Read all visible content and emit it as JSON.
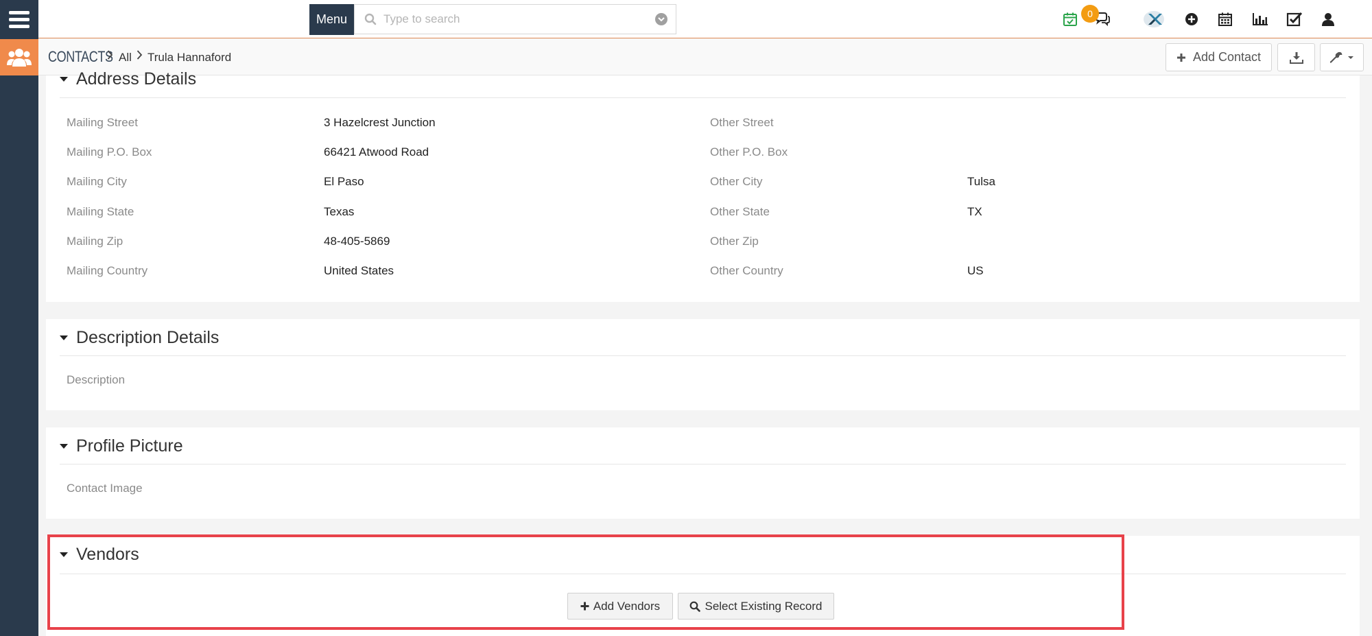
{
  "topbar": {
    "menu_label": "Menu",
    "search_placeholder": "Type to search",
    "notification_count": "0",
    "icons": [
      "calendar-check-icon",
      "chat-icon",
      "app-logo-icon",
      "plus-circle-icon",
      "calendar-icon",
      "bar-chart-icon",
      "checkbox-icon",
      "user-icon"
    ],
    "accent_color": "#f08a4b",
    "nav_color": "#2a3a4c"
  },
  "breadcrumb": {
    "module": "CONTACTS",
    "all": "All",
    "record": "Trula Hannaford"
  },
  "header_actions": {
    "add_contact": "Add Contact"
  },
  "address": {
    "title": "Address Details",
    "left": [
      {
        "label": "Mailing Street",
        "value": "3 Hazelcrest Junction"
      },
      {
        "label": "Mailing P.O. Box",
        "value": "66421 Atwood Road"
      },
      {
        "label": "Mailing City",
        "value": "El Paso"
      },
      {
        "label": "Mailing State",
        "value": "Texas"
      },
      {
        "label": "Mailing Zip",
        "value": "48-405-5869"
      },
      {
        "label": "Mailing Country",
        "value": "United States"
      }
    ],
    "right": [
      {
        "label": "Other Street",
        "value": ""
      },
      {
        "label": "Other P.O. Box",
        "value": ""
      },
      {
        "label": "Other City",
        "value": "Tulsa"
      },
      {
        "label": "Other State",
        "value": "TX"
      },
      {
        "label": "Other Zip",
        "value": ""
      },
      {
        "label": "Other Country",
        "value": "US"
      }
    ]
  },
  "description": {
    "title": "Description Details",
    "label": "Description"
  },
  "picture": {
    "title": "Profile Picture",
    "label": "Contact Image"
  },
  "vendors": {
    "title": "Vendors",
    "add_label": "Add Vendors",
    "select_label": "Select Existing Record",
    "highlight_color": "#e8424a"
  }
}
